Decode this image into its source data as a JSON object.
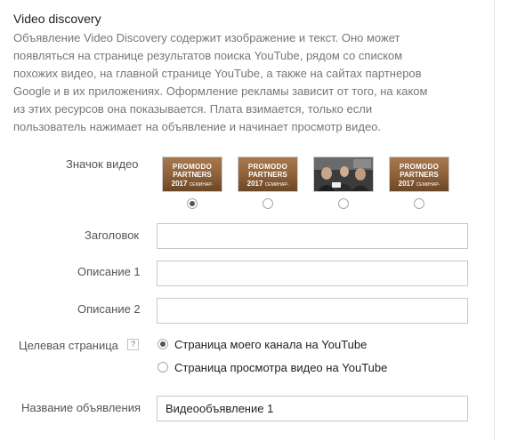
{
  "section": {
    "title": "Video discovery",
    "description_lines": [
      "Объявление Video Discovery содержит изображение и текст. Оно может",
      "появляться на странице результатов поиска YouTube, рядом со списком",
      "похожих видео, на главной странице YouTube, а также на сайтах партнеров",
      "Google и в их приложениях. Оформление рекламы зависит от того, на каком",
      "из этих ресурсов она показывается. Плата взимается, только если",
      "пользователь нажимает на объявление и начинает просмотр видео."
    ]
  },
  "thumbnail": {
    "label": "Значок видео",
    "options": [
      {
        "type": "brand",
        "line1": "PROMODO",
        "line2": "PARTNERS",
        "year": "2017",
        "tag": "СЕМИНАР-ПРАКТИКУМ",
        "selected": true
      },
      {
        "type": "brand",
        "line1": "PROMODO",
        "line2": "PARTNERS",
        "year": "2017",
        "tag": "СЕМИНАР-ПРАКТИКУМ",
        "selected": false
      },
      {
        "type": "photo",
        "selected": false
      },
      {
        "type": "brand",
        "line1": "PROMODO",
        "line2": "PARTNERS",
        "year": "2017",
        "tag": "СЕМИНАР-ПРАКТИКУМ",
        "selected": false
      }
    ],
    "brand_color": "#8d6038"
  },
  "fields": {
    "headline": {
      "label": "Заголовок",
      "value": ""
    },
    "description1": {
      "label": "Описание 1",
      "value": ""
    },
    "description2": {
      "label": "Описание 2",
      "value": ""
    },
    "ad_name": {
      "label": "Название объявления",
      "value": "Видеообъявление 1"
    }
  },
  "landing_page": {
    "label": "Целевая страница",
    "help_icon": "?",
    "options": [
      {
        "label": "Страница моего канала на YouTube",
        "selected": true
      },
      {
        "label": "Страница просмотра видео на YouTube",
        "selected": false
      }
    ]
  }
}
